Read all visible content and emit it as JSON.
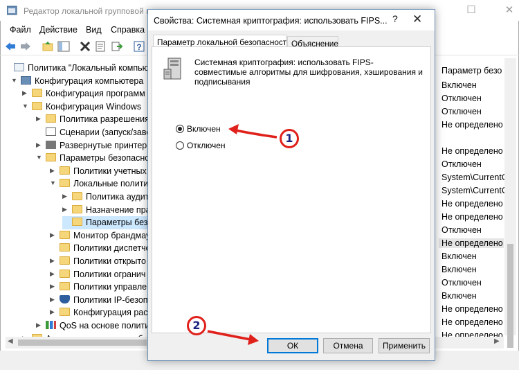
{
  "bg_window": {
    "title": "Редактор локальной групповой п",
    "caption_min": "—",
    "caption_max": "☐",
    "menu": [
      "Файл",
      "Действие",
      "Вид",
      "Справка"
    ],
    "tree": [
      {
        "label": "Политика \"Локальный компьюте",
        "arrow": "",
        "icon": "policy"
      },
      {
        "label": "Конфигурация компьютера",
        "arrow": "▼",
        "icon": "computer"
      },
      {
        "label": "Конфигурация программ",
        "arrow": "▶",
        "icon": "folder"
      },
      {
        "label": "Конфигурация Windows",
        "arrow": "▼",
        "icon": "folder"
      },
      {
        "label": "Политика разрешения",
        "arrow": "▶",
        "icon": "folder"
      },
      {
        "label": "Сценарии (запуск/заве",
        "arrow": "",
        "icon": "script"
      },
      {
        "label": "Развернутые принтеры",
        "arrow": "▶",
        "icon": "printer"
      },
      {
        "label": "Параметры безопасно",
        "arrow": "▼",
        "icon": "folder-lock"
      },
      {
        "label": "Политики учетных",
        "arrow": "▶",
        "icon": "folder-lock"
      },
      {
        "label": "Локальные полити",
        "arrow": "▼",
        "icon": "folder-lock"
      },
      {
        "label": "Политика аудит",
        "arrow": "▶",
        "icon": "folder-lock"
      },
      {
        "label": "Назначение пра",
        "arrow": "▶",
        "icon": "folder-lock"
      },
      {
        "label": "Параметры безо",
        "arrow": "",
        "icon": "folder-lock",
        "selected": true
      },
      {
        "label": "Монитор брандмау",
        "arrow": "▶",
        "icon": "folder"
      },
      {
        "label": "Политики диспетче",
        "arrow": "",
        "icon": "folder"
      },
      {
        "label": "Политики открыто",
        "arrow": "▶",
        "icon": "folder"
      },
      {
        "label": "Политики огранич",
        "arrow": "▶",
        "icon": "folder"
      },
      {
        "label": "Политики управлен",
        "arrow": "▶",
        "icon": "folder"
      },
      {
        "label": "Политики IP-безоп",
        "arrow": "▶",
        "icon": "shield"
      },
      {
        "label": "Конфигурация рас",
        "arrow": "▶",
        "icon": "folder"
      },
      {
        "label": "QoS на основе полити",
        "arrow": "▶",
        "icon": "chart"
      },
      {
        "label": "Административные шабл",
        "arrow": "▶",
        "icon": "folder"
      }
    ],
    "right_header": "Параметр безо",
    "right_values": [
      "Включен",
      "Отключен",
      "Отключен",
      "Не определено",
      "",
      "Не определено",
      "Отключен",
      "System\\CurrentC",
      "System\\CurrentC",
      "Не определено",
      "Не определено",
      "Отключен",
      "Не определено",
      "Включен",
      "Включен",
      "Отключен",
      "Включен",
      "Не определено",
      "Не определено",
      "Не определено"
    ]
  },
  "dialog": {
    "title": "Свойства: Системная криптография: использовать FIPS...",
    "help": "?",
    "close": "✕",
    "tabs": [
      "Параметр локальной безопасности",
      "Объяснение"
    ],
    "description": "Системная криптография: использовать FIPS-совместимые алгоритмы для шифрования, хэширования и подписывания",
    "options": [
      {
        "label": "Включен",
        "checked": true
      },
      {
        "label": "Отключен",
        "checked": false
      }
    ],
    "buttons": {
      "ok": "ОК",
      "cancel": "Отмена",
      "apply": "Применить"
    }
  },
  "annotations": {
    "badge1": "1",
    "badge2": "2",
    "color": "#e0201b"
  }
}
